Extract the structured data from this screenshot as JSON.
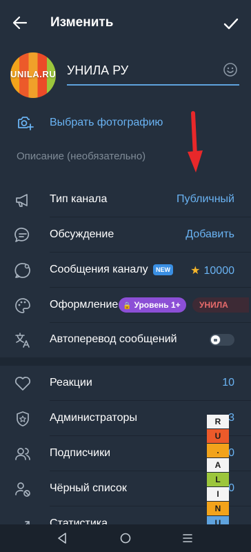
{
  "header": {
    "title": "Изменить",
    "back_icon": "arrow-left-icon",
    "confirm_icon": "check-icon"
  },
  "channel": {
    "avatar_text": "UNILA.RU",
    "name": "УНИЛА РУ",
    "choose_photo": "Выбрать фотографию",
    "description_placeholder": "Описание (необязательно)"
  },
  "settings_primary": [
    {
      "label": "Тип канала",
      "value": "Публичный",
      "icon": "megaphone-icon"
    },
    {
      "label": "Обсуждение",
      "value": "Добавить",
      "icon": "chat-bubble-icon"
    },
    {
      "label": "Сообщения каналу",
      "badge": "NEW",
      "value": "10000",
      "icon": "message-circle-icon"
    },
    {
      "label": "Оформление",
      "level_badge": "Уровень 1+",
      "chip": "УНИЛА",
      "icon": "palette-icon"
    },
    {
      "label": "Автоперевод сообщений",
      "toggle": false,
      "icon": "translate-icon"
    }
  ],
  "settings_secondary": [
    {
      "label": "Реакции",
      "value": "10",
      "icon": "heart-icon"
    },
    {
      "label": "Администраторы",
      "value": "3",
      "icon": "shield-star-icon"
    },
    {
      "label": "Подписчики",
      "value": "30",
      "icon": "users-icon"
    },
    {
      "label": "Чёрный список",
      "value": "0",
      "icon": "user-block-icon"
    },
    {
      "label": "Статистика",
      "value": "",
      "icon": "stats-icon"
    }
  ],
  "watermark": [
    "R",
    "U",
    ".",
    "A",
    "L",
    "I",
    "N",
    "U"
  ],
  "colors": {
    "background": "#1d2733",
    "surface": "#242f3d",
    "accent": "#6ab3f3",
    "level_badge": "#8c4fd6",
    "arrow": "#e8282a"
  }
}
